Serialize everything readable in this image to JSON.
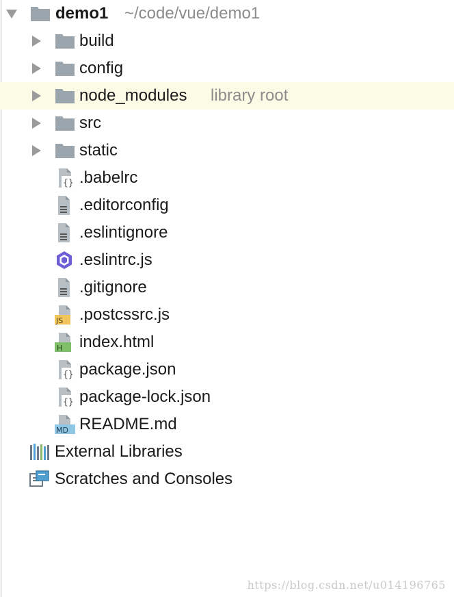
{
  "root": {
    "name": "demo1",
    "path": "~/code/vue/demo1"
  },
  "folders": [
    {
      "label": "build"
    },
    {
      "label": "config"
    },
    {
      "label": "node_modules",
      "hint": "library root"
    },
    {
      "label": "src"
    },
    {
      "label": "static"
    }
  ],
  "files": [
    {
      "label": ".babelrc",
      "icon": "json-config-icon"
    },
    {
      "label": ".editorconfig",
      "icon": "text-file-icon"
    },
    {
      "label": ".eslintignore",
      "icon": "text-file-icon"
    },
    {
      "label": ".eslintrc.js",
      "icon": "eslint-icon"
    },
    {
      "label": ".gitignore",
      "icon": "text-file-icon"
    },
    {
      "label": ".postcssrc.js",
      "icon": "js-file-icon"
    },
    {
      "label": "index.html",
      "icon": "html-file-icon"
    },
    {
      "label": "package.json",
      "icon": "json-config-icon"
    },
    {
      "label": "package-lock.json",
      "icon": "json-config-icon"
    },
    {
      "label": "README.md",
      "icon": "markdown-file-icon"
    }
  ],
  "bottom": {
    "external_libraries": "External Libraries",
    "scratches": "Scratches and Consoles"
  },
  "icon_badges": {
    "js": "JS",
    "html": "H",
    "md": "MD",
    "json": "{}"
  },
  "watermark": "https://blog.csdn.net/u014196765",
  "colors": {
    "folder": "#9aa5ad",
    "highlight_row": "#fcfbe6",
    "hint_text": "#8c8c8c",
    "eslint_purple": "#6f5fd6",
    "js_badge": "#f2c55c",
    "html_badge": "#7fbf6a",
    "md_badge": "#8fc6e3"
  }
}
